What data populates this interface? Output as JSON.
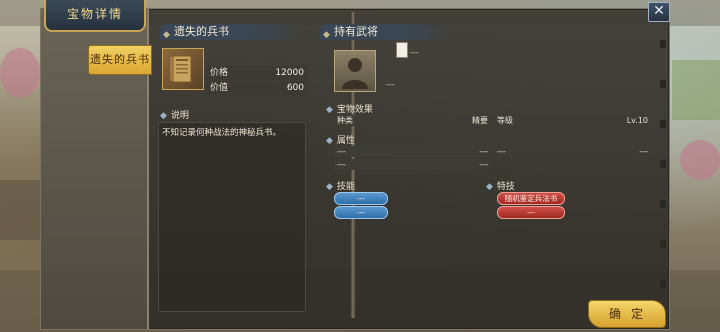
{
  "window": {
    "title": "宝物详情",
    "close_symbol": "✕",
    "confirm_label": "确定"
  },
  "side_tabs": [
    {
      "label": "遗失的兵书",
      "active": true
    }
  ],
  "left_panel": {
    "section_title": "遗失的兵书",
    "item_icon": "scroll-book-icon",
    "stats": [
      {
        "key": "价格",
        "value": "12000"
      },
      {
        "key": "价值",
        "value": "600"
      }
    ],
    "description_label": "说明",
    "description_text": "不知记录何种战法的神秘兵书。"
  },
  "right_panel": {
    "section_title": "持有武将",
    "holder_name": "---",
    "holder_sub": "---",
    "effect": {
      "label": "宝物效果",
      "type_key": "种类",
      "type_value": "精要",
      "level_key": "等级",
      "level_value": "Lv.10"
    },
    "attributes": {
      "label": "属性",
      "cells": [
        "---",
        "---",
        "---",
        "---",
        "---",
        "---"
      ]
    },
    "skills": {
      "label": "技能",
      "items": [
        "---",
        "---"
      ]
    },
    "special": {
      "label": "特技",
      "items": [
        "随机鉴定兵法书",
        "---"
      ]
    }
  },
  "colors": {
    "accent_gold": "#f2cf61",
    "skill_blue": "#2f6ea8",
    "special_red": "#9e2a22"
  }
}
